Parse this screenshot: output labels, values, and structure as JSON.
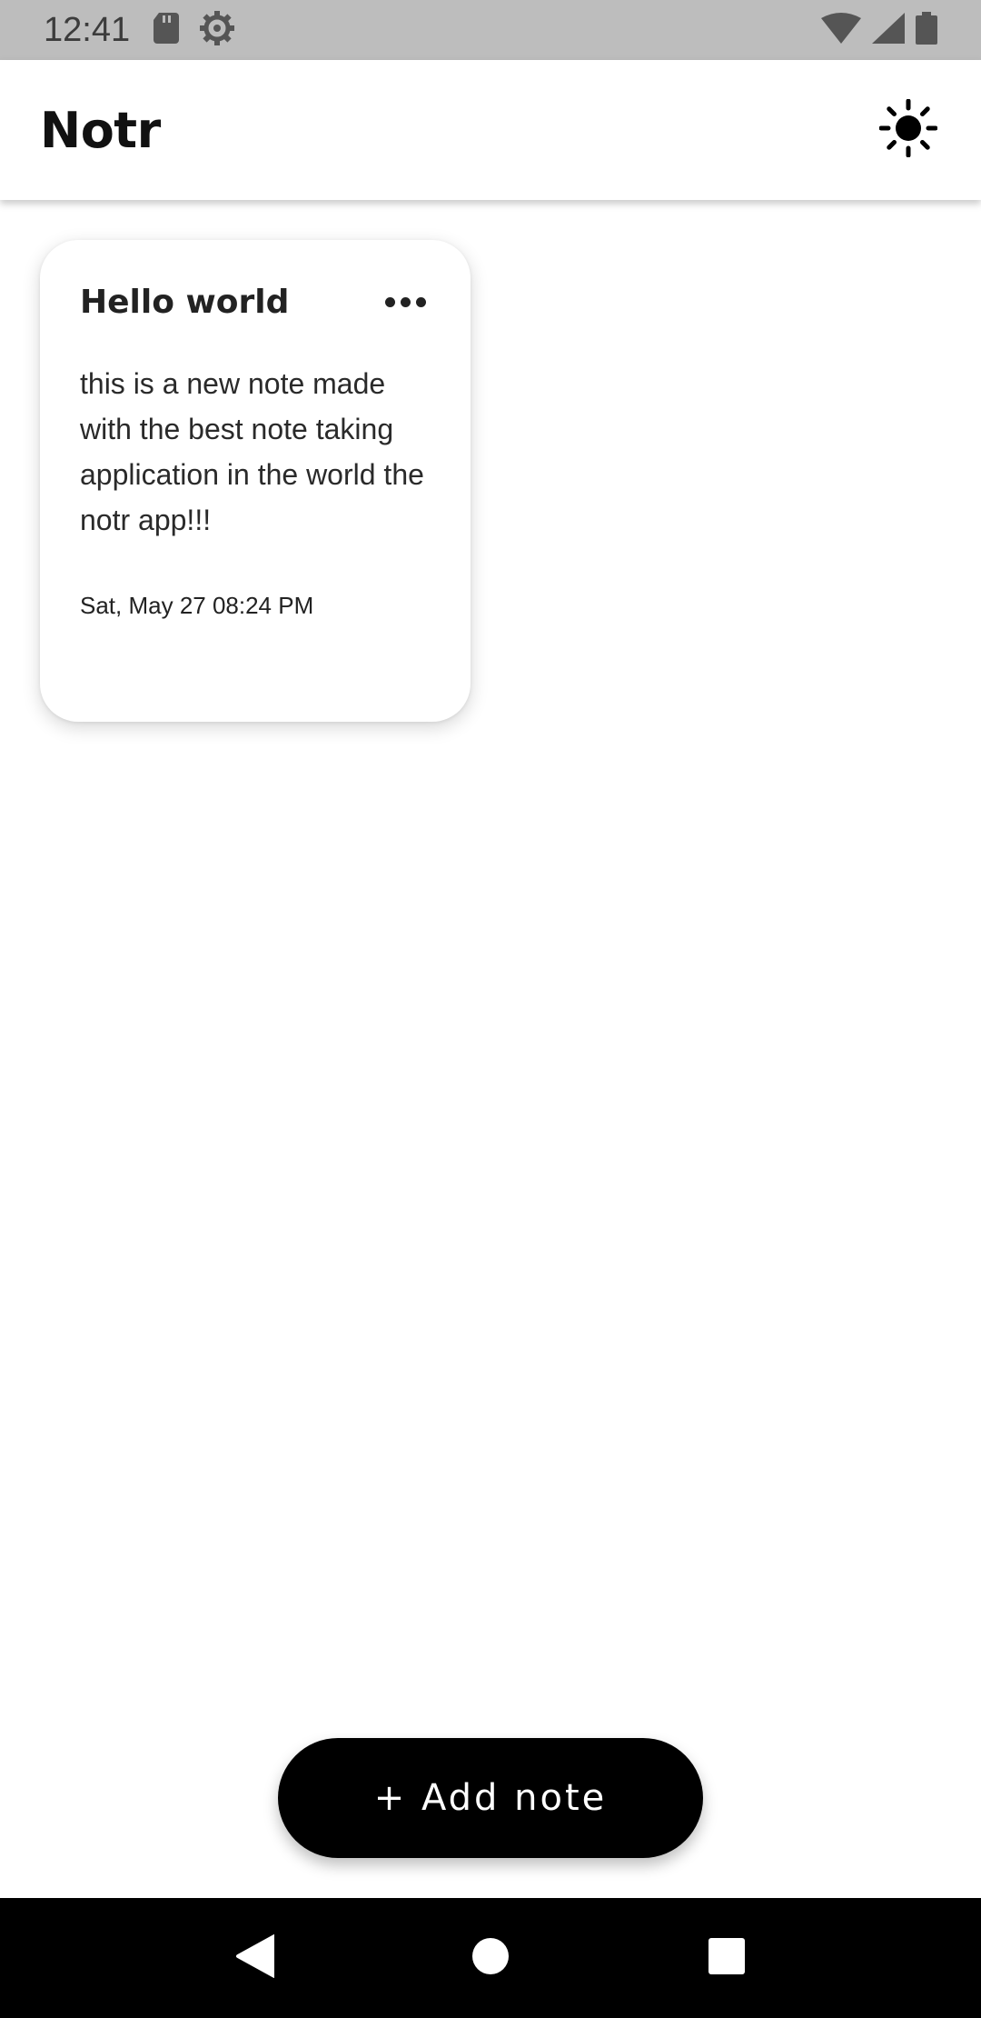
{
  "status_bar": {
    "time": "12:41",
    "icons": [
      "sd-card-icon",
      "settings-gear-icon",
      "wifi-icon",
      "cell-signal-icon",
      "battery-icon"
    ]
  },
  "app_bar": {
    "title": "Notr",
    "theme_icon": "sun-icon"
  },
  "notes": [
    {
      "title": "Hello world",
      "body": "this is a new note made with the best note taking application in the world the notr app!!!",
      "date": "Sat, May 27 08:24 PM",
      "menu_icon": "more-horizontal-icon"
    }
  ],
  "add_note_button": {
    "label": "+ Add note"
  },
  "nav_bar": {
    "icons": [
      "back-icon",
      "home-icon",
      "recents-icon"
    ]
  },
  "colors": {
    "status_bar_bg": "#bdbdbd",
    "app_bar_bg": "#ffffff",
    "button_bg": "#000000",
    "nav_bar_bg": "#000000"
  }
}
